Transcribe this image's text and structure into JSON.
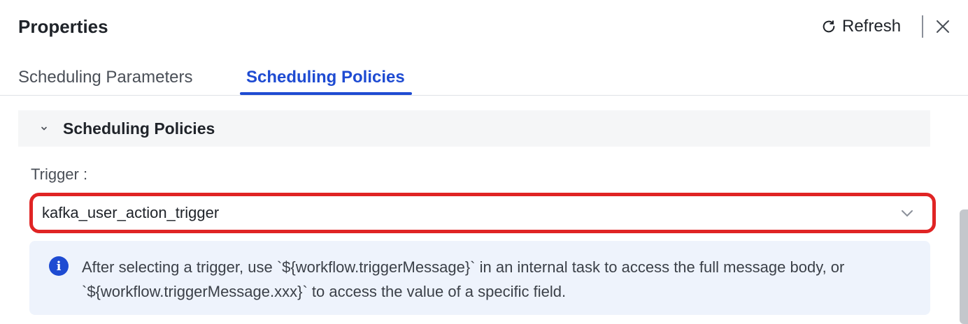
{
  "header": {
    "title": "Properties",
    "refresh_label": "Refresh",
    "refresh_icon": "refresh-icon",
    "close_icon": "close-icon"
  },
  "tabs": [
    {
      "label": "Scheduling Parameters",
      "active": false
    },
    {
      "label": "Scheduling Policies",
      "active": true
    }
  ],
  "section": {
    "title": "Scheduling Policies",
    "expanded": true,
    "icon": "chevron-down-icon"
  },
  "trigger": {
    "label": "Trigger :",
    "value": "kafka_user_action_trigger",
    "icon": "chevron-down-icon"
  },
  "info": {
    "icon": "info-icon",
    "text": "After selecting a trigger, use `${workflow.triggerMessage}` in an internal task to access the full message body, or `${workflow.triggerMessage.xxx}` to access the value of a specific field."
  },
  "colors": {
    "accent": "#1e4bd2",
    "highlight_border": "#e02424",
    "info_bg": "#eef3fc",
    "section_bg": "#f5f6f7"
  }
}
